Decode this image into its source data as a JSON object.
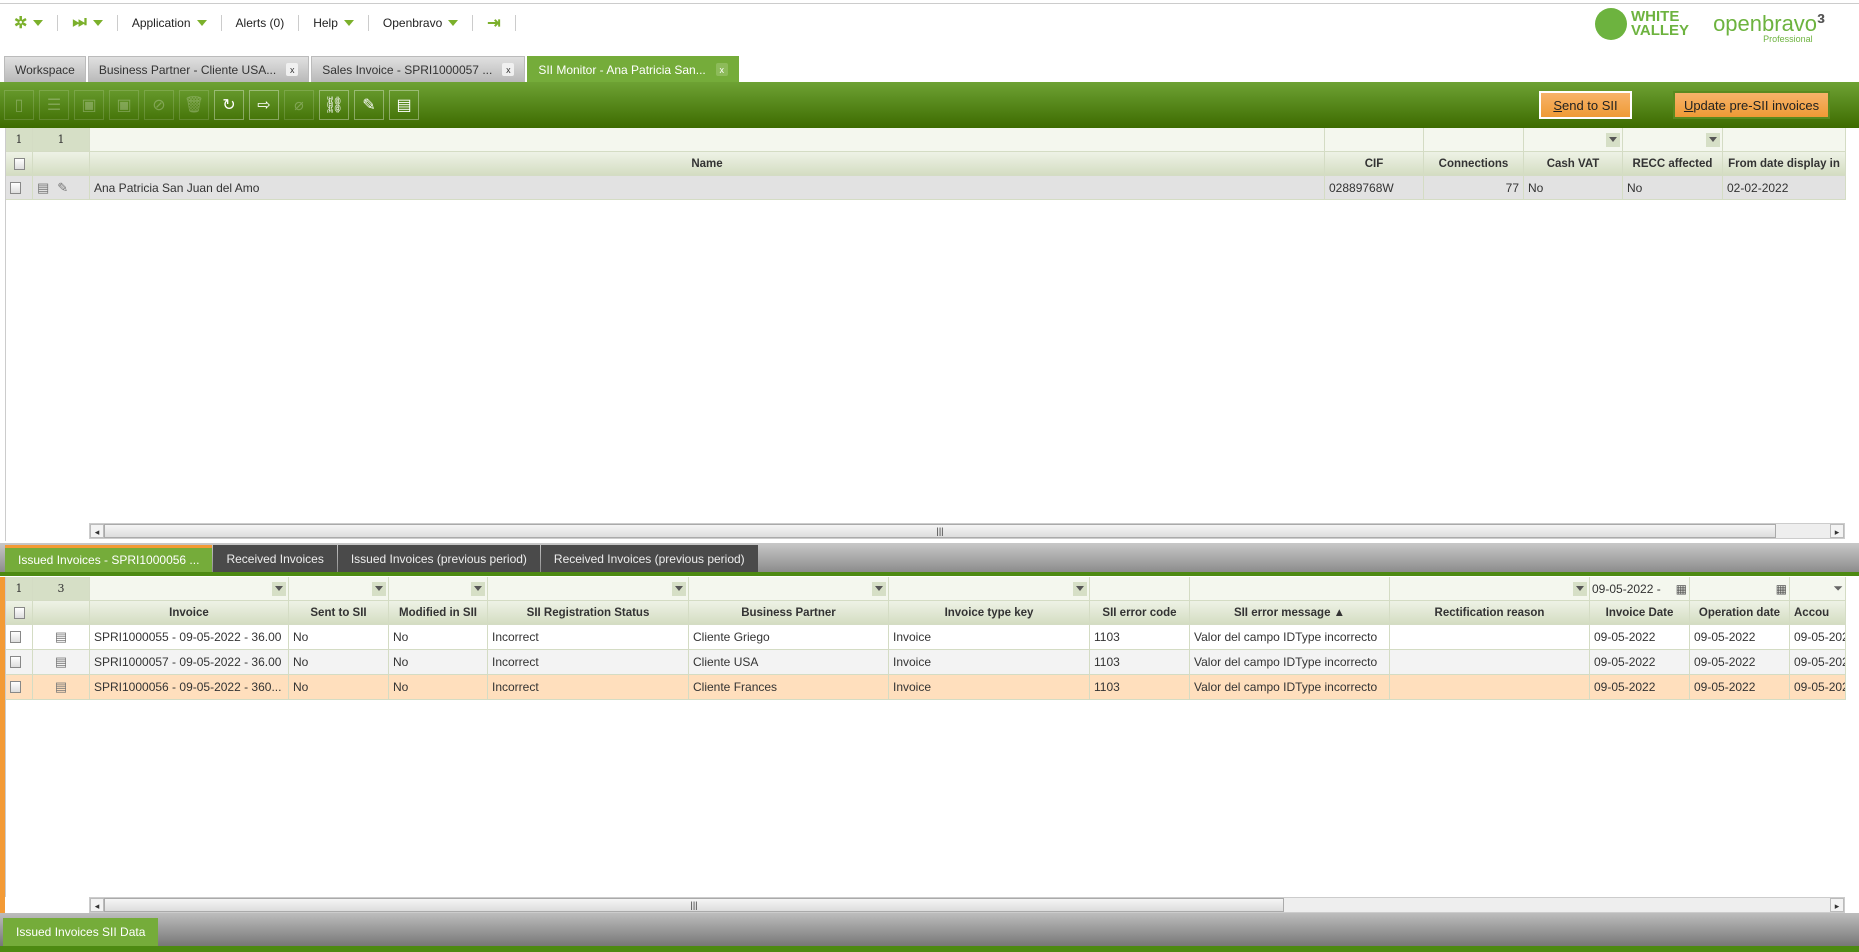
{
  "menu": {
    "application": "Application",
    "alerts": "Alerts (0)",
    "help": "Help",
    "openbravo": "Openbravo"
  },
  "logos": {
    "wv": "WHITE VALLEY",
    "ob": "openbravo",
    "ob_ver": "3",
    "ob_edition": "Professional"
  },
  "tabs": [
    {
      "label": "Workspace"
    },
    {
      "label": "Business Partner - Cliente USA..."
    },
    {
      "label": "Sales Invoice - SPRI1000057 ..."
    },
    {
      "label": "SII Monitor - Ana Patricia San..."
    }
  ],
  "close_glyph": "x",
  "toolbar": {
    "send": "Send to SII",
    "send_key": "S",
    "send_rest": "end to SII",
    "update_key": "U",
    "update_rest": "pdate pre-SII invoices"
  },
  "top_grid": {
    "page": "1",
    "count": "1",
    "columns": [
      "Name",
      "CIF",
      "Connections",
      "Cash VAT",
      "RECC affected",
      "From date display in"
    ],
    "rows": [
      [
        "Ana Patricia San Juan del Amo",
        "02889768W",
        "77",
        "No",
        "No",
        "02-02-2022"
      ]
    ]
  },
  "child_tabs": [
    "Issued Invoices - SPRI1000056 ...",
    "Received Invoices",
    "Issued Invoices (previous period)",
    "Received Invoices (previous period)"
  ],
  "bottom_grid": {
    "page": "1",
    "count": "3",
    "date_filter": "09-05-2022 -",
    "columns": [
      "Invoice",
      "Sent to SII",
      "Modified in SII",
      "SII Registration Status",
      "Business Partner",
      "Invoice type key",
      "SII error code",
      "SII error message ▲",
      "Rectification reason",
      "Invoice Date",
      "Operation date",
      "Accou"
    ],
    "rows": [
      [
        "SPRI1000055 - 09-05-2022 - 36.00",
        "No",
        "No",
        "Incorrect",
        "Cliente Griego",
        "Invoice",
        "1103",
        "Valor del campo IDType incorrecto",
        "",
        "09-05-2022",
        "09-05-2022",
        "09-05-202"
      ],
      [
        "SPRI1000057 - 09-05-2022 - 36.00",
        "No",
        "No",
        "Incorrect",
        "Cliente USA",
        "Invoice",
        "1103",
        "Valor del campo IDType incorrecto",
        "",
        "09-05-2022",
        "09-05-2022",
        "09-05-202"
      ],
      [
        "SPRI1000056 - 09-05-2022 - 360...",
        "No",
        "No",
        "Incorrect",
        "Cliente Frances",
        "Invoice",
        "1103",
        "Valor del campo IDType incorrecto",
        "",
        "09-05-2022",
        "09-05-2022",
        "09-05-202"
      ]
    ]
  },
  "bottom_tab": "Issued Invoices SII Data"
}
